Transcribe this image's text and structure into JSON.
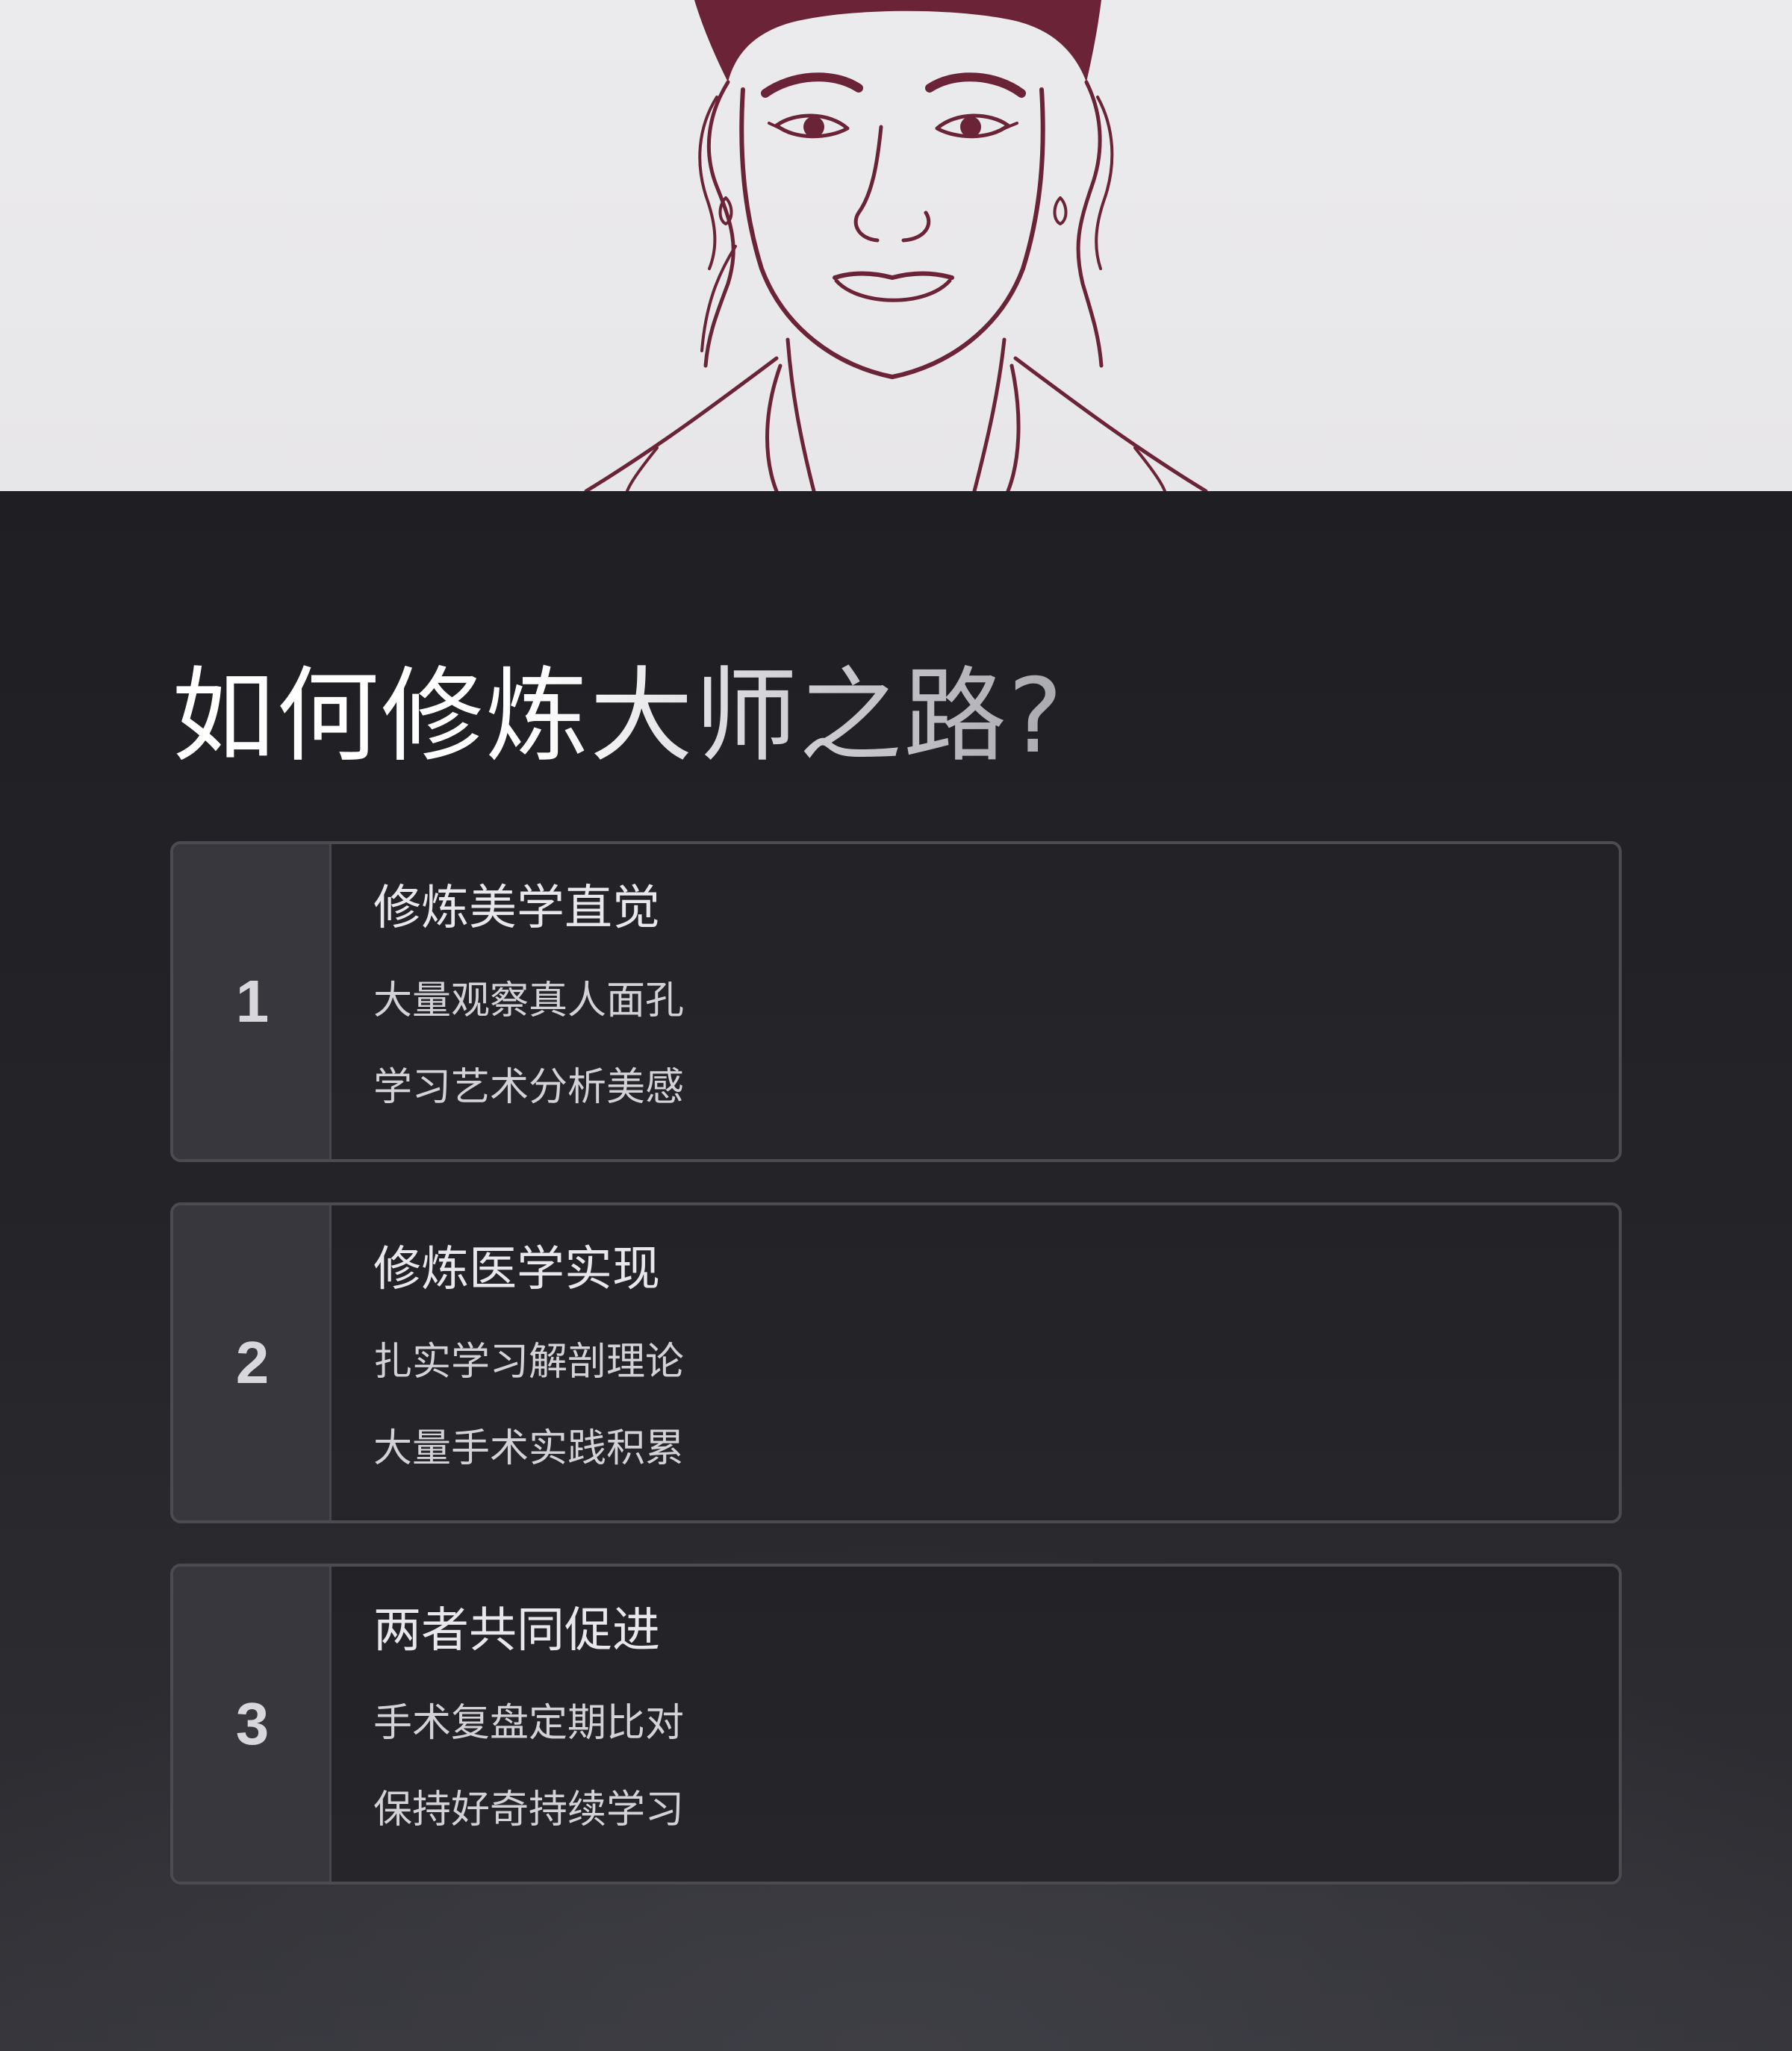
{
  "hero": {
    "illustration_icon": "woman-line-portrait-icon",
    "line_color": "#6b2337",
    "background_color": "#e9e8ea"
  },
  "page": {
    "title": "如何修炼大师之路?"
  },
  "steps": [
    {
      "number": "1",
      "heading": "修炼美学直觉",
      "points": [
        "大量观察真人面孔",
        "学习艺术分析美感"
      ]
    },
    {
      "number": "2",
      "heading": "修炼医学实现",
      "points": [
        "扎实学习解剖理论",
        "大量手术实践积累"
      ]
    },
    {
      "number": "3",
      "heading": "两者共同促进",
      "points": [
        "手术复盘定期比对",
        "保持好奇持续学习"
      ]
    }
  ],
  "colors": {
    "dark_background": "#1f1f23",
    "card_border": "#4b4b51",
    "number_column": "#37373d",
    "text_primary": "#e8e8ec"
  }
}
